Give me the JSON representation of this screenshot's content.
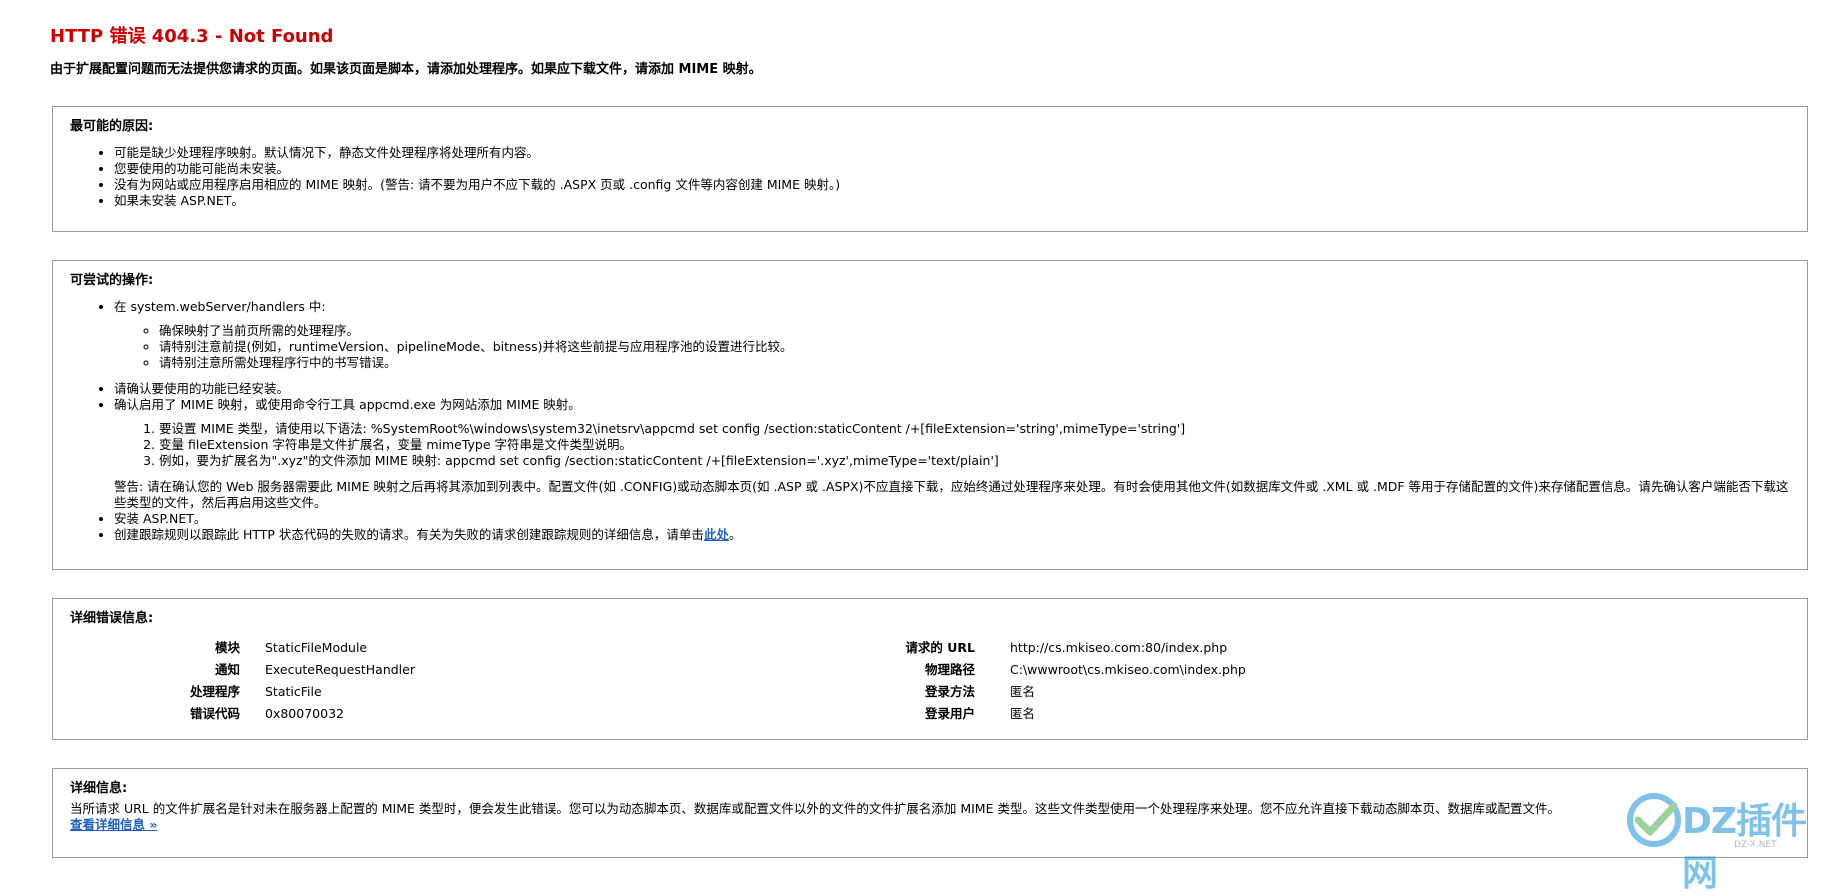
{
  "header": {
    "title": "HTTP 错误 404.3 - Not Found",
    "subtitle": "由于扩展配置问题而无法提供您请求的页面。如果该页面是脚本，请添加处理程序。如果应下载文件，请添加 MIME 映射。"
  },
  "causes": {
    "heading": "最可能的原因:",
    "items": [
      "可能是缺少处理程序映射。默认情况下，静态文件处理程序将处理所有内容。",
      "您要使用的功能可能尚未安装。",
      "没有为网站或应用程序启用相应的 MIME 映射。(警告: 请不要为用户不应下载的 .ASPX 页或 .config 文件等内容创建 MIME 映射。)",
      "如果未安装 ASP.NET。"
    ]
  },
  "actions": {
    "heading": "可尝试的操作:",
    "item1": "在 system.webServer/handlers 中:",
    "item1_sub": [
      "确保映射了当前页所需的处理程序。",
      "请特别注意前提(例如，runtimeVersion、pipelineMode、bitness)并将这些前提与应用程序池的设置进行比较。",
      "请特别注意所需处理程序行中的书写错误。"
    ],
    "item2": "请确认要使用的功能已经安装。",
    "item3": "确认启用了 MIME 映射，或使用命令行工具 appcmd.exe 为网站添加 MIME 映射。",
    "item3_steps": [
      "要设置 MIME 类型，请使用以下语法: %SystemRoot%\\windows\\system32\\inetsrv\\appcmd set config /section:staticContent /+[fileExtension='string',mimeType='string']",
      "变量 fileExtension 字符串是文件扩展名，变量 mimeType 字符串是文件类型说明。",
      "例如，要为扩展名为\".xyz\"的文件添加 MIME 映射: appcmd set config /section:staticContent /+[fileExtension='.xyz',mimeType='text/plain']"
    ],
    "item3_warning": "警告: 请在确认您的 Web 服务器需要此 MIME 映射之后再将其添加到列表中。配置文件(如 .CONFIG)或动态脚本页(如 .ASP 或 .ASPX)不应直接下载，应始终通过处理程序来处理。有时会使用其他文件(如数据库文件或 .XML 或 .MDF 等用于存储配置的文件)来存储配置信息。请先确认客户端能否下载这些类型的文件，然后再启用这些文件。",
    "item4": "安装 ASP.NET。",
    "item5_prefix": "创建跟踪规则以跟踪此 HTTP 状态代码的失败的请求。有关为失败的请求创建跟踪规则的详细信息，请单击",
    "item5_link": "此处",
    "item5_suffix": "。"
  },
  "details": {
    "heading": "详细错误信息:",
    "left": [
      {
        "label": "模块",
        "value": "StaticFileModule"
      },
      {
        "label": "通知",
        "value": "ExecuteRequestHandler"
      },
      {
        "label": "处理程序",
        "value": "StaticFile"
      },
      {
        "label": "错误代码",
        "value": "0x80070032"
      }
    ],
    "right": [
      {
        "label": "请求的 URL",
        "value": "http://cs.mkiseo.com:80/index.php"
      },
      {
        "label": "物理路径",
        "value": "C:\\wwwroot\\cs.mkiseo.com\\index.php"
      },
      {
        "label": "登录方法",
        "value": "匿名"
      },
      {
        "label": "登录用户",
        "value": "匿名"
      }
    ]
  },
  "more": {
    "heading": "详细信息:",
    "text": "当所请求 URL 的文件扩展名是针对未在服务器上配置的 MIME 类型时，便会发生此错误。您可以为动态脚本页、数据库或配置文件以外的文件的文件扩展名添加 MIME 类型。这些文件类型使用一个处理程序来处理。您不应允许直接下载动态脚本页、数据库或配置文件。",
    "link": "查看详细信息 »"
  },
  "watermark": {
    "text": "DZ插件网",
    "sub": "DZ-X.NET",
    "colors": {
      "blue": "#1a8fd8",
      "green": "#4caf50"
    }
  }
}
